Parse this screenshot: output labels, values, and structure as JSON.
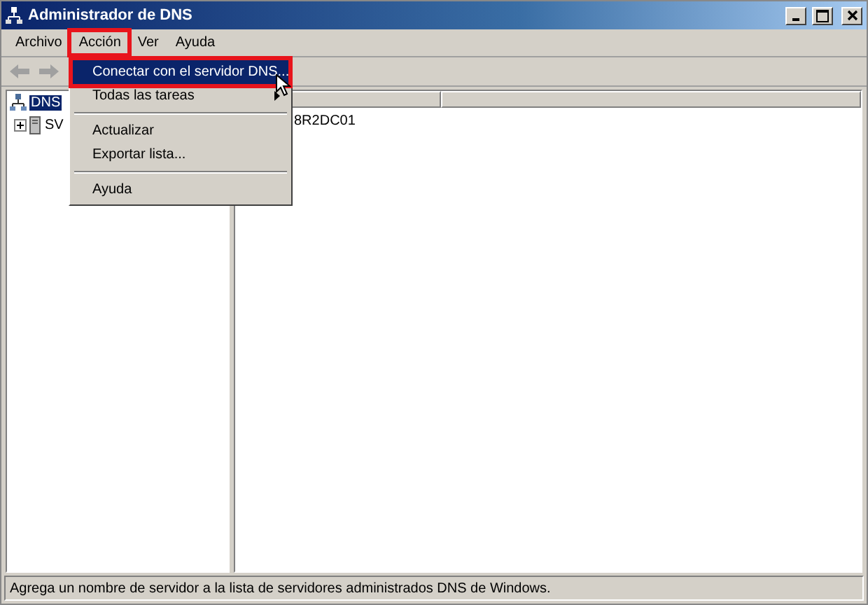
{
  "window": {
    "title": "Administrador de DNS"
  },
  "menu_bar": [
    {
      "label": "Archivo",
      "selected": false,
      "annotated": false
    },
    {
      "label": "Acción",
      "selected": true,
      "annotated": true
    },
    {
      "label": "Ver",
      "selected": false,
      "annotated": false
    },
    {
      "label": "Ayuda",
      "selected": false,
      "annotated": false
    }
  ],
  "dropdown": [
    {
      "kind": "item",
      "label": "Conectar con el servidor DNS...",
      "selected": true,
      "annotated": true,
      "submenu": false
    },
    {
      "kind": "item",
      "label": "Todas las tareas",
      "selected": false,
      "annotated": false,
      "submenu": true
    },
    {
      "kind": "separator"
    },
    {
      "kind": "item",
      "label": "Actualizar",
      "selected": false,
      "annotated": false,
      "submenu": false
    },
    {
      "kind": "item",
      "label": "Exportar lista...",
      "selected": false,
      "annotated": false,
      "submenu": false
    },
    {
      "kind": "separator"
    },
    {
      "kind": "item",
      "label": "Ayuda",
      "selected": false,
      "annotated": false,
      "submenu": false
    }
  ],
  "tree": [
    {
      "label": "DNS",
      "selected": true,
      "children": [
        {
          "label": "SV",
          "selected": false,
          "expanded": false
        }
      ]
    }
  ],
  "list": {
    "rows": [
      "8R2DC01"
    ]
  },
  "status_bar": "Agrega un nombre de servidor a la lista de servidores administrados DNS de Windows."
}
